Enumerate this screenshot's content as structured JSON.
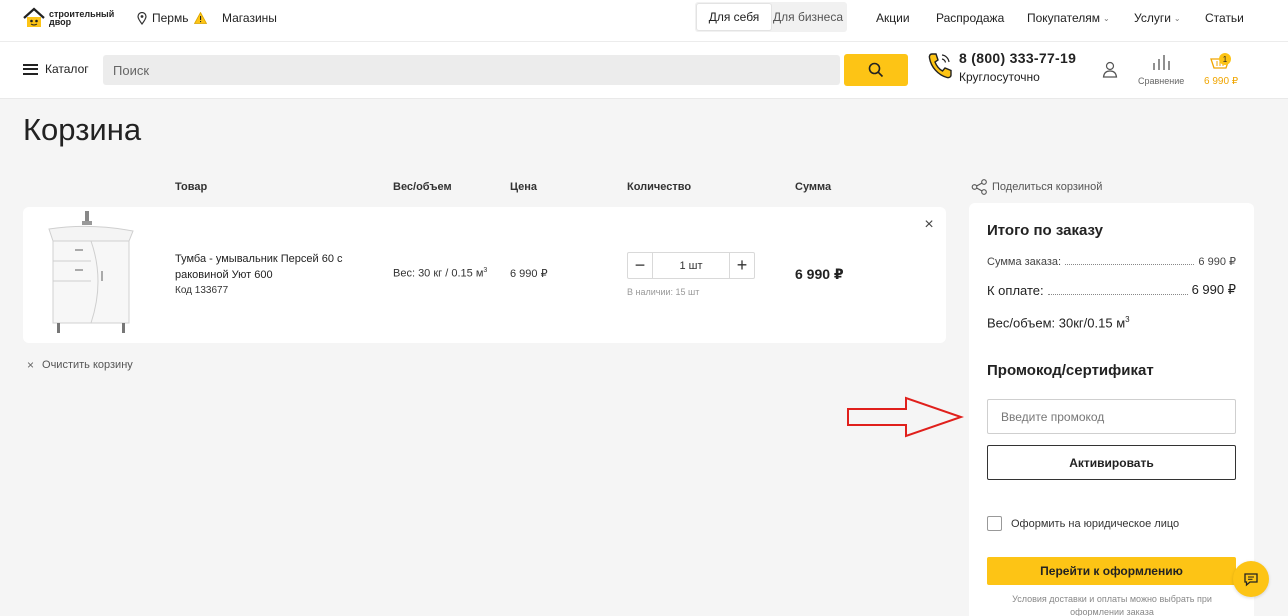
{
  "brand": {
    "logo_text": "строительный двор",
    "accent": "#fdc415"
  },
  "topbar": {
    "city": "Пермь",
    "stores": "Магазины",
    "segments": [
      "Для себя",
      "Для бизнеса"
    ],
    "nav": [
      "Акции",
      "Распродажа",
      "Покупателям",
      "Услуги",
      "Статьи"
    ]
  },
  "header": {
    "catalog": "Каталог",
    "search_placeholder": "Поиск",
    "phone": "8 (800) 333-77-19",
    "phone_hours": "Круглосуточно",
    "compare_label": "Сравнение",
    "cart_count": "1",
    "cart_total": "6 990 ₽"
  },
  "page": {
    "title": "Корзина",
    "columns": [
      "Товар",
      "Вес/объем",
      "Цена",
      "Количество",
      "Сумма"
    ],
    "share": "Поделиться корзиной",
    "clear": "Очистить корзину"
  },
  "item": {
    "name": "Тумба - умывальник Персей 60 с раковиной Уют 600",
    "code": "Код 133677",
    "weight": "Вес: 30 кг / 0.15 м",
    "weight_sup": "3",
    "price": "6 990 ₽",
    "qty": "1 шт",
    "stock": "В наличии: 15 шт",
    "sum": "6 990 ₽"
  },
  "summary": {
    "title": "Итого по заказу",
    "order_sum_label": "Сумма заказа:",
    "order_sum": "6 990 ₽",
    "to_pay_label": "К оплате:",
    "to_pay": "6 990 ₽",
    "weight": "Вес/объем: 30кг/0.15 м",
    "weight_sup": "3",
    "promo_title": "Промокод/сертификат",
    "promo_placeholder": "Введите промокод",
    "activate": "Активировать",
    "legal_entity": "Оформить на юридическое лицо",
    "checkout": "Перейти к оформлению",
    "note": "Условия доставки и оплаты можно выбрать при оформлении заказа"
  }
}
